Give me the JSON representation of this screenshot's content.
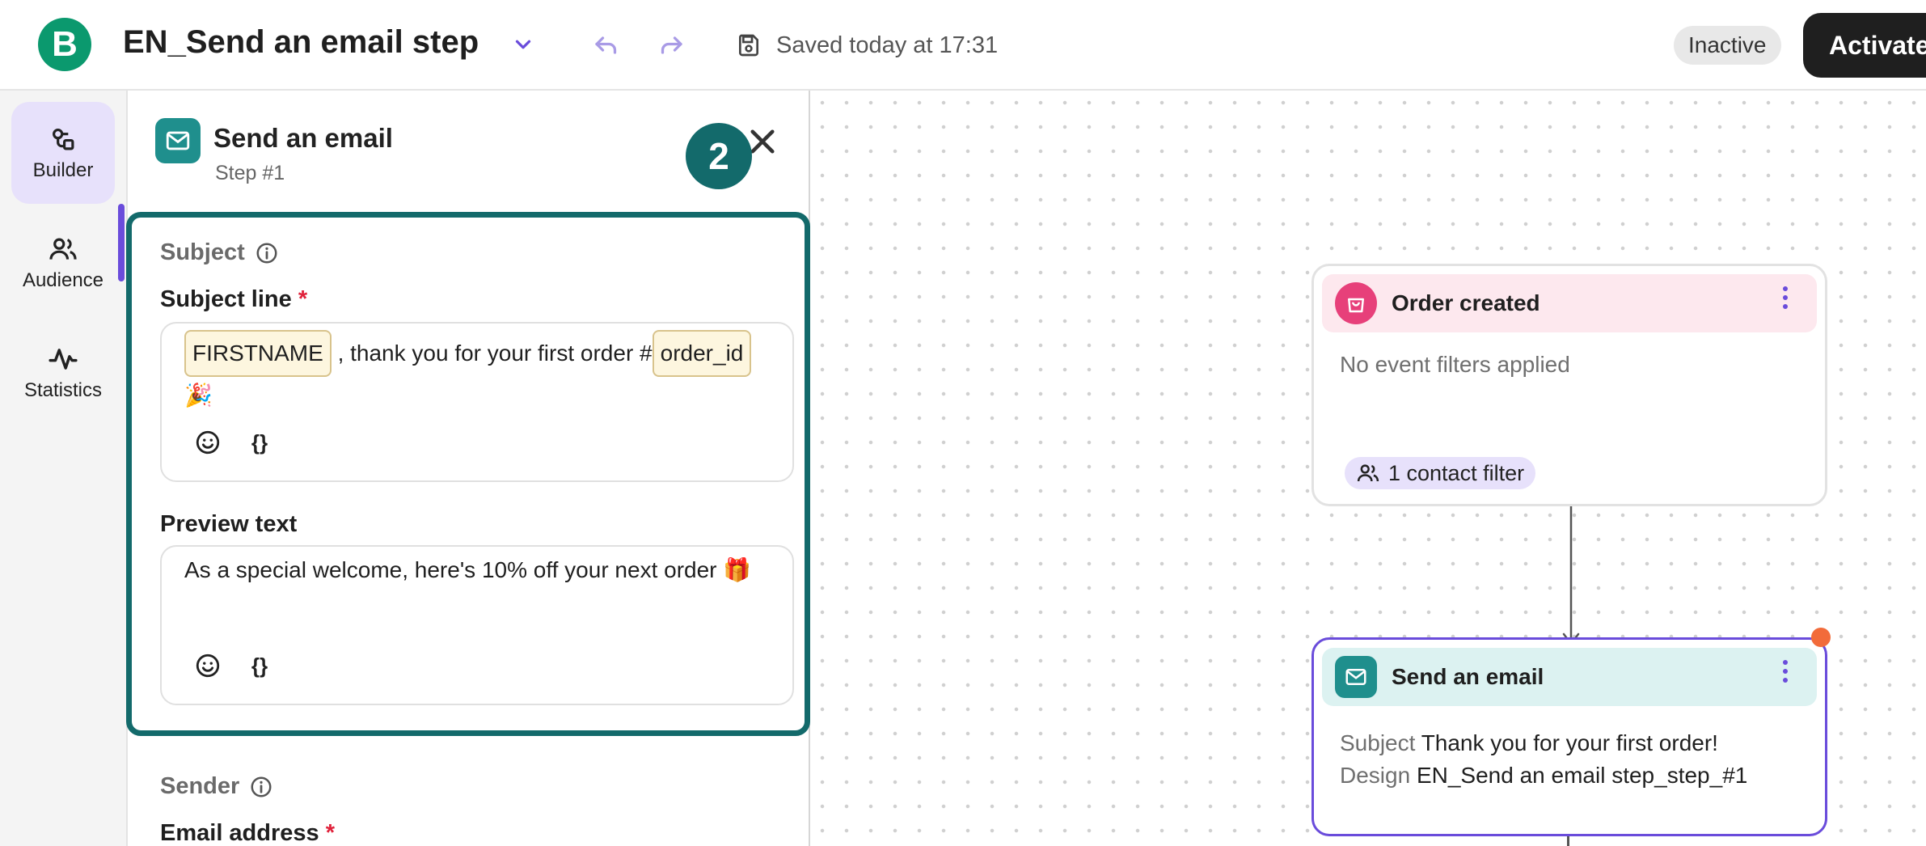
{
  "header": {
    "logo_letter": "B",
    "workflow_title": "EN_Send an email step",
    "saved_status": "Saved today at 17:31",
    "status_badge": "Inactive",
    "activate_label": "Activate"
  },
  "leftnav": {
    "items": [
      {
        "label": "Builder",
        "icon": "builder-icon",
        "active": true
      },
      {
        "label": "Audience",
        "icon": "audience-icon",
        "active": false
      },
      {
        "label": "Statistics",
        "icon": "statistics-icon",
        "active": false
      }
    ]
  },
  "panel": {
    "title": "Send an email",
    "step": "Step #1",
    "callout_number": "2",
    "subject_section": "Subject",
    "subject_line_label": "Subject line",
    "required_mark": "*",
    "subject_token_1": "FIRSTNAME",
    "subject_text": ", thank you for your first order #",
    "subject_token_2": "order_id",
    "subject_emoji": "🎉",
    "preview_text_label": "Preview text",
    "preview_text_value": "As a special welcome, here's 10% off your next order 🎁",
    "braces_label": "{}",
    "sender_section": "Sender",
    "email_address_label": "Email address"
  },
  "canvas": {
    "trigger_card": {
      "title": "Order created",
      "body": "No event filters applied",
      "filter_pill": "1 contact filter"
    },
    "email_card": {
      "title": "Send an email",
      "subject_key": "Subject",
      "subject_value": "Thank you for your first order!",
      "design_key": "Design",
      "design_value": "EN_Send an email step_step_#1"
    }
  },
  "colors": {
    "brand": "#0b996e",
    "teal_highlight": "#136a6b",
    "purple_accent": "#6a4cdb",
    "notification_dot": "#f26b3a"
  }
}
